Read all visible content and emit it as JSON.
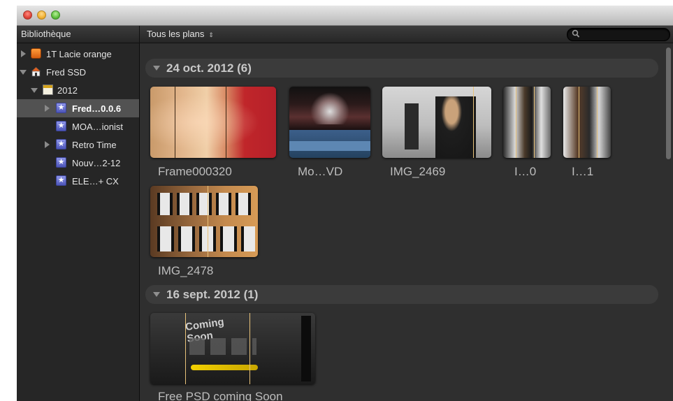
{
  "window": {
    "traffic_lights": {
      "close": "close-light",
      "minimize": "minimize-light",
      "zoom": "zoom-light"
    }
  },
  "header": {
    "library_title": "Bibliothèque",
    "filter_label": "Tous les plans",
    "filter_arrow": "⇕",
    "search_placeholder": ""
  },
  "sidebar": {
    "items": [
      {
        "label": "1T Lacie orange"
      },
      {
        "label": "Fred SSD"
      },
      {
        "label": "2012"
      },
      {
        "label": "Fred…0.0.6"
      },
      {
        "label": "MOA…ionist"
      },
      {
        "label": "Retro Time"
      },
      {
        "label": "Nouv…2-12"
      },
      {
        "label": "ELE…+ CX"
      }
    ]
  },
  "groups": [
    {
      "title": "24 oct. 2012  (6)"
    },
    {
      "title": "16 sept. 2012  (1)"
    }
  ],
  "clips": [
    {
      "name": "Frame000320"
    },
    {
      "name": "Mo…VD"
    },
    {
      "name": "IMG_2469"
    },
    {
      "name": "I…0"
    },
    {
      "name": "I…1"
    },
    {
      "name": "IMG_2478"
    },
    {
      "name": "Free PSD coming Soon"
    }
  ],
  "colors": {
    "accent_selection": "#525252",
    "skimmer": "#e8c27a",
    "event_star": "#6a72d6"
  }
}
